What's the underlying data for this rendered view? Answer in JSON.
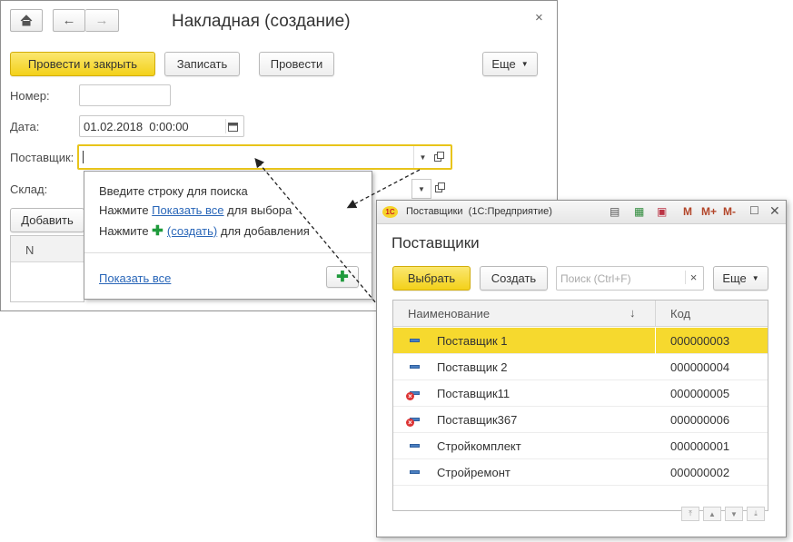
{
  "main": {
    "title": "Накладная (создание)",
    "close": "×",
    "btn_post_close": "Провести и закрыть",
    "btn_write": "Записать",
    "btn_post": "Провести",
    "btn_more": "Еще",
    "lbl_number": "Номер:",
    "lbl_date": "Дата:",
    "date_value": "01.02.2018  0:00:00",
    "lbl_supplier": "Поставщик:",
    "lbl_warehouse": "Склад:",
    "btn_add": "Добавить",
    "col_n": "N"
  },
  "dropdown": {
    "line1": "Введите строку для поиска",
    "line2_pre": "Нажмите ",
    "line2_link": "Показать все",
    "line2_post": " для выбора",
    "line3_pre": "Нажмите ",
    "line3_link": "(создать)",
    "line3_post": " для добавления",
    "show_all": "Показать все"
  },
  "suppliers": {
    "window_title": "Поставщики  (1С:Предприятие)",
    "heading": "Поставщики",
    "btn_select": "Выбрать",
    "btn_create": "Создать",
    "search_placeholder": "Поиск (Ctrl+F)",
    "btn_more": "Еще",
    "col_name": "Наименование",
    "col_code": "Код",
    "tb_m": "M",
    "tb_mplus": "M+",
    "tb_mminus": "M-",
    "rows": [
      {
        "name": "Поставщик 1",
        "code": "000000003"
      },
      {
        "name": "Поставщик 2",
        "code": "000000004"
      },
      {
        "name": "Поставщик11",
        "code": "000000005"
      },
      {
        "name": "Поставщик367",
        "code": "000000006"
      },
      {
        "name": "Стройкомплект",
        "code": "000000001"
      },
      {
        "name": "Стройремонт",
        "code": "000000002"
      }
    ]
  },
  "colors": {
    "accent_yellow": "#f3d11a",
    "focus_border": "#e8c41a",
    "link": "#2966b8"
  }
}
